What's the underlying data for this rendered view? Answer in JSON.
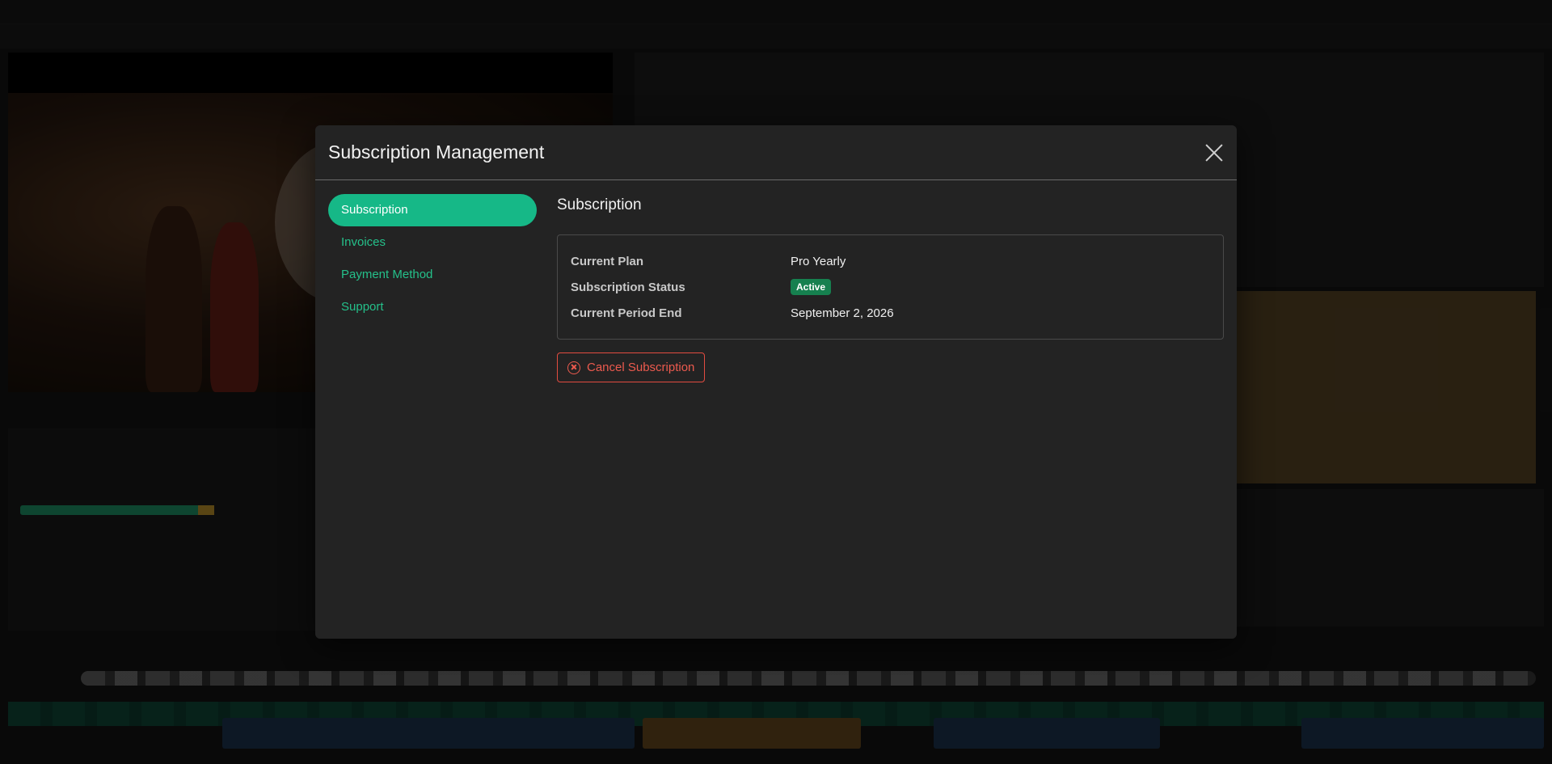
{
  "modal": {
    "title": "Subscription Management"
  },
  "nav": {
    "items": [
      {
        "label": "Subscription",
        "active": true
      },
      {
        "label": "Invoices",
        "active": false
      },
      {
        "label": "Payment Method",
        "active": false
      },
      {
        "label": "Support",
        "active": false
      }
    ]
  },
  "subscription": {
    "section_title": "Subscription",
    "rows": [
      {
        "label": "Current Plan",
        "value": "Pro Yearly"
      },
      {
        "label": "Subscription Status",
        "value": "Active"
      },
      {
        "label": "Current Period End",
        "value": "September 2, 2026"
      }
    ],
    "cancel_label": "Cancel Subscription"
  },
  "colors": {
    "accent": "#16b887",
    "danger": "#ec5a4e",
    "badge": "#16804f",
    "modal_bg": "#232323"
  },
  "icons": {
    "close": "close-icon",
    "cancel": "x-circle-icon"
  }
}
